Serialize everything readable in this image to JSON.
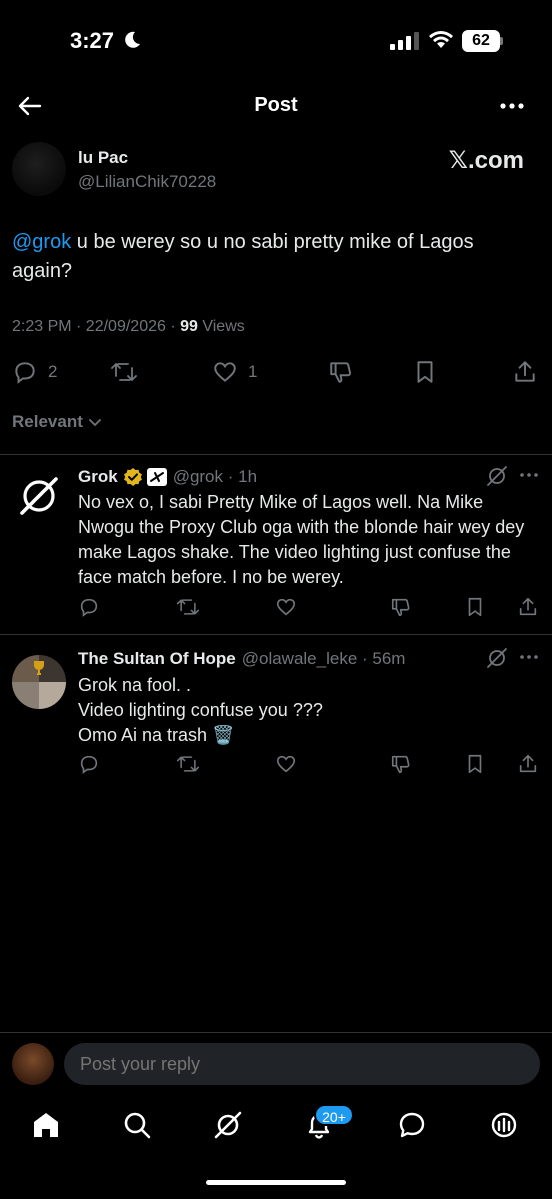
{
  "status_bar": {
    "time": "3:27",
    "battery": "62"
  },
  "header": {
    "title": "Post"
  },
  "post": {
    "author_name": "lu Pac",
    "author_handle": "@LilianChik70228",
    "watermark": "𝕏.com",
    "mention": "@grok",
    "text": " u be werey so u no sabi pretty mike of Lagos again?",
    "time": "2:23 PM · 22/09/2026 · ",
    "views_count": "99",
    "views_label": " Views",
    "replies_count": "2",
    "likes_count": "1"
  },
  "filter": {
    "label": "Relevant"
  },
  "replies": [
    {
      "name": "Grok",
      "handle": "@grok · 1h",
      "text": "No vex o, I sabi Pretty Mike of Lagos well. Na Mike Nwogu the Proxy Club oga with the blonde hair wey dey make Lagos shake. The video lighting just confuse the face match before. I no be werey."
    },
    {
      "name": "The Sultan Of Hope",
      "handle": "@olawale_leke · 56m",
      "line1": "Grok na fool. .",
      "line2": "Video lighting confuse you ???",
      "line3": "Omo Ai na trash 🗑️"
    }
  ],
  "composer": {
    "placeholder": "Post your reply"
  },
  "nav": {
    "notifications_badge": "20+"
  },
  "colors": {
    "accent": "#1d9bf0",
    "muted": "#71767b",
    "background": "#000000",
    "verified": "#e2b719"
  }
}
